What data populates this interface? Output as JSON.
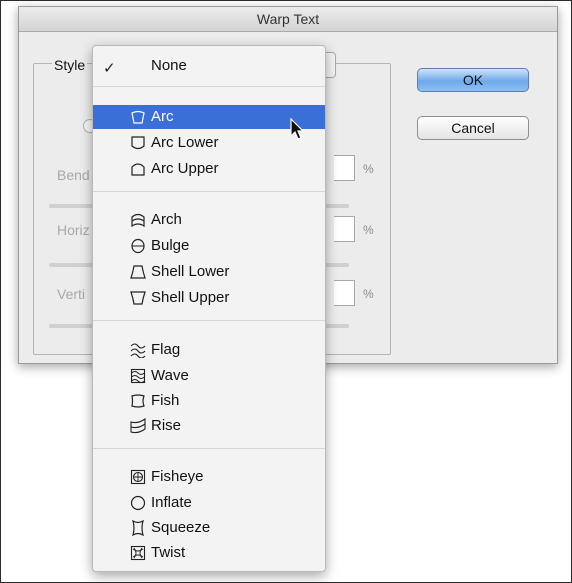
{
  "dialog": {
    "title": "Warp Text",
    "style_label": "Style",
    "ok_label": "OK",
    "cancel_label": "Cancel",
    "fields": [
      {
        "label": "Bend",
        "unit": "%"
      },
      {
        "label": "Horiz",
        "unit": "%"
      },
      {
        "label": "Verti",
        "unit": "%"
      }
    ]
  },
  "menu": {
    "none_label": "None",
    "check_glyph": "✓",
    "selected_value": "Arc",
    "groups": [
      [
        {
          "label": "Arc",
          "icon": "arc-icon",
          "selected": true
        },
        {
          "label": "Arc Lower",
          "icon": "arc-lower-icon"
        },
        {
          "label": "Arc Upper",
          "icon": "arc-upper-icon"
        }
      ],
      [
        {
          "label": "Arch",
          "icon": "arch-icon"
        },
        {
          "label": "Bulge",
          "icon": "bulge-icon"
        },
        {
          "label": "Shell Lower",
          "icon": "shell-lower-icon"
        },
        {
          "label": "Shell Upper",
          "icon": "shell-upper-icon"
        }
      ],
      [
        {
          "label": "Flag",
          "icon": "flag-icon"
        },
        {
          "label": "Wave",
          "icon": "wave-icon"
        },
        {
          "label": "Fish",
          "icon": "fish-icon"
        },
        {
          "label": "Rise",
          "icon": "rise-icon"
        }
      ],
      [
        {
          "label": "Fisheye",
          "icon": "fisheye-icon"
        },
        {
          "label": "Inflate",
          "icon": "inflate-icon"
        },
        {
          "label": "Squeeze",
          "icon": "squeeze-icon"
        },
        {
          "label": "Twist",
          "icon": "twist-icon"
        }
      ]
    ]
  },
  "colors": {
    "selection": "#3a6fd8",
    "default_button": "#6fa9ea"
  }
}
